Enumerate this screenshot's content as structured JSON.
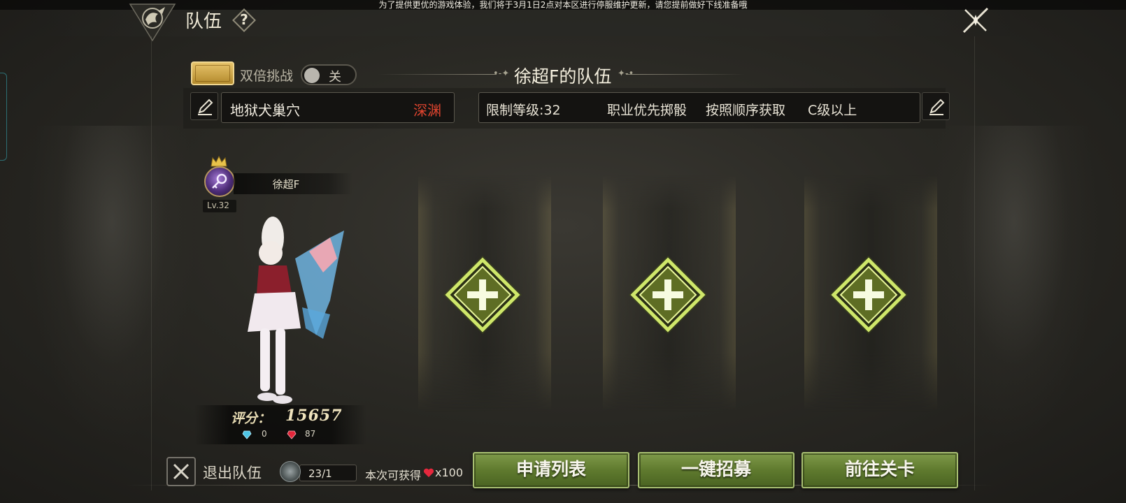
{
  "notice": "为了提供更优的游戏体验，我们将于3月1日2点对本区进行停服维护更新，请您提前做好下线准备哦",
  "header": {
    "title": "队伍",
    "help_label": "?"
  },
  "double_challenge": {
    "label": "双倍挑战",
    "toggle_state": "关"
  },
  "team": {
    "title": "徐超F的队伍",
    "dungeon_name": "地狱犬巢穴",
    "difficulty": "深渊",
    "difficulty_color": "#e2452f",
    "rules": [
      "限制等级:32",
      "职业优先掷骰",
      "按照顺序获取",
      "C级以上"
    ]
  },
  "member": {
    "name": "徐超F",
    "level": "Lv.32",
    "score_label": "评分：",
    "score": "15657",
    "blue_gems": "0",
    "red_gems": "87"
  },
  "empty_slots": 3,
  "footer": {
    "leave_label": "退出队伍",
    "ticket_count": "23/1",
    "reward_label": "本次可获得",
    "reward_amount": "x100",
    "buttons": [
      "申请列表",
      "一键招募",
      "前往关卡"
    ]
  },
  "colors": {
    "accent_gold": "#e7c36a",
    "button_green": "#6a8636",
    "slot_glow": "#d9ef7a"
  }
}
